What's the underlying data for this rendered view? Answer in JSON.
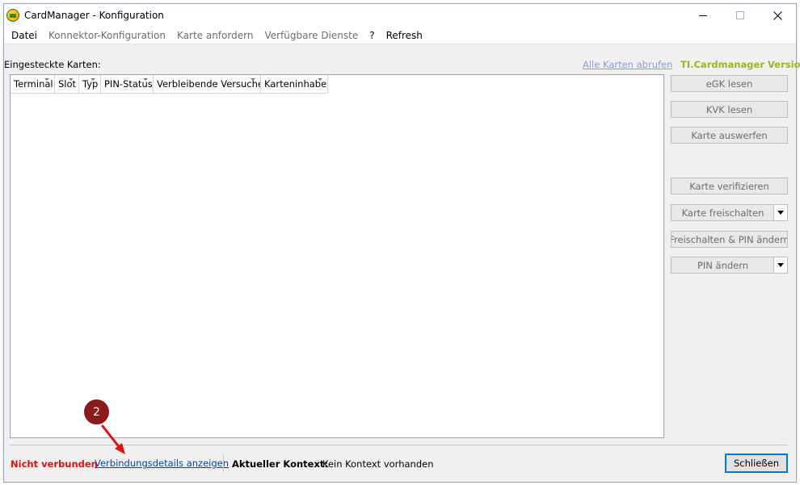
{
  "window": {
    "title": "CardManager - Konfiguration"
  },
  "menu": [
    {
      "label": "Datei",
      "enabled": true
    },
    {
      "label": "Konnektor-Konfiguration",
      "enabled": false
    },
    {
      "label": "Karte anfordern",
      "enabled": false
    },
    {
      "label": "Verfügbare Dienste",
      "enabled": false
    },
    {
      "label": "?",
      "enabled": true
    },
    {
      "label": "Refresh",
      "enabled": true
    }
  ],
  "cards": {
    "label": "Eingesteckte Karten:",
    "fetch_all_link": "Alle Karten abrufen",
    "version_label": "TI.Cardmanager Version",
    "columns": [
      "Terminal",
      "Slot",
      "Typ",
      "PIN-Status",
      "Verbleibende Versuche",
      "Karteninhaber"
    ],
    "rows": []
  },
  "actions": [
    {
      "label": "eGK lesen",
      "split": false
    },
    {
      "label": "KVK lesen",
      "split": false
    },
    {
      "label": "Karte auswerfen",
      "split": false
    },
    {
      "label": "Karte verifizieren",
      "split": false
    },
    {
      "label": "Karte freischalten",
      "split": true
    },
    {
      "label": "Freischalten & PIN ändern",
      "split": false
    },
    {
      "label": "PIN ändern",
      "split": true
    }
  ],
  "status": {
    "connection": "Nicht verbunden",
    "details_link": "Verbindungsdetails anzeigen",
    "context_label": "Aktueller Kontext:",
    "context_value": "Kein Kontext vorhanden"
  },
  "close_label": "Schließen",
  "annotation": {
    "number": "2",
    "color": "#8b1a1a",
    "arrow_color": "#e01010"
  },
  "colors": {
    "version": "#9ab71f",
    "not_connected": "#e01010",
    "link": "#0645ad",
    "disabled_link": "#8a9fd4",
    "focus_border": "#0078d7"
  }
}
